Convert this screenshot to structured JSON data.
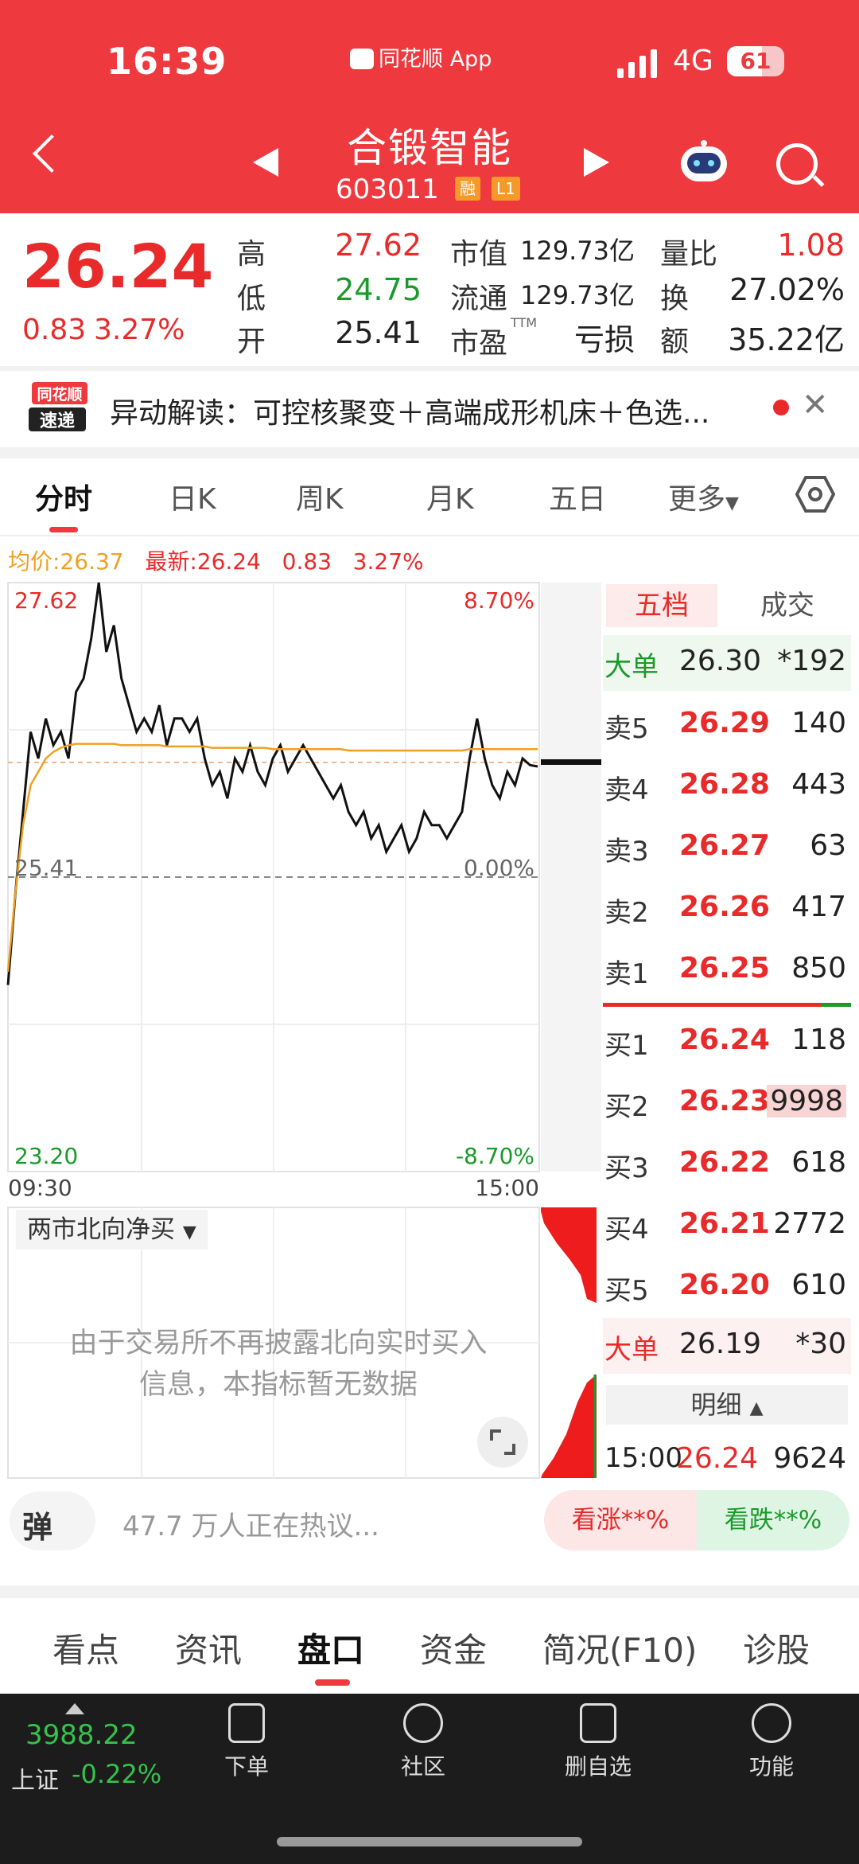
{
  "status": {
    "time": "16:39",
    "app": "同花顺 App",
    "network": "4G",
    "battery": "61"
  },
  "header": {
    "name": "合锻智能",
    "code": "603011",
    "tags": [
      "融",
      "L1"
    ]
  },
  "quote": {
    "price": "26.24",
    "change": "0.83",
    "change_pct": "3.27%",
    "high_label": "高",
    "high": "27.62",
    "low_label": "低",
    "low": "24.75",
    "open_label": "开",
    "open": "25.41",
    "mktcap_label": "市值",
    "mktcap": "129.73亿",
    "float_label": "流通",
    "float": "129.73亿",
    "pe_label": "市盈",
    "pe_sup": "TTM",
    "pe": "亏损",
    "volratio_label": "量比",
    "volratio": "1.08",
    "turnover_label": "换",
    "turnover": "27.02%",
    "amount_label": "额",
    "amount": "35.22亿"
  },
  "news": {
    "logo_top": "同花顺",
    "logo_bottom": "速递",
    "text": "异动解读：可控核聚变＋高端成形机床＋色选..."
  },
  "tabs": [
    "分时",
    "日K",
    "周K",
    "月K",
    "五日",
    "更多"
  ],
  "avgline": {
    "avg_label": "均价:",
    "avg": "26.37",
    "latest_label": "最新:",
    "latest": "26.24",
    "chg": "0.83",
    "pct": "3.27%"
  },
  "chart_data": {
    "type": "line",
    "title": "",
    "y_labels": {
      "top_left": "27.62",
      "top_right": "8.70%",
      "mid_left": "25.41",
      "mid_right": "0.00%",
      "bottom_left": "23.20",
      "bottom_right": "-8.70%"
    },
    "x_labels": [
      "09:30",
      "15:00"
    ],
    "ylim": [
      23.2,
      27.62
    ],
    "prev_close": 25.41,
    "series": [
      {
        "name": "最新",
        "color": "#111111",
        "values": [
          24.6,
          25.3,
          25.9,
          26.5,
          26.3,
          26.6,
          26.4,
          26.5,
          26.3,
          26.8,
          26.9,
          27.2,
          27.62,
          27.1,
          27.3,
          26.9,
          26.7,
          26.5,
          26.6,
          26.5,
          26.7,
          26.4,
          26.6,
          26.6,
          26.5,
          26.6,
          26.3,
          26.1,
          26.2,
          26.0,
          26.3,
          26.2,
          26.4,
          26.2,
          26.1,
          26.3,
          26.4,
          26.2,
          26.3,
          26.4,
          26.3,
          26.2,
          26.1,
          26.0,
          26.1,
          25.9,
          25.8,
          25.9,
          25.7,
          25.8,
          25.6,
          25.7,
          25.8,
          25.6,
          25.7,
          25.9,
          25.8,
          25.8,
          25.7,
          25.8,
          25.9,
          26.3,
          26.6,
          26.3,
          26.1,
          26.0,
          26.2,
          26.1,
          26.3,
          26.25,
          26.24
        ]
      },
      {
        "name": "均价",
        "color": "#f0a020",
        "values": [
          24.7,
          25.3,
          25.8,
          26.1,
          26.2,
          26.3,
          26.35,
          26.38,
          26.4,
          26.41,
          26.41,
          26.41,
          26.41,
          26.41,
          26.41,
          26.4,
          26.4,
          26.4,
          26.4,
          26.4,
          26.4,
          26.39,
          26.39,
          26.39,
          26.39,
          26.39,
          26.39,
          26.38,
          26.38,
          26.38,
          26.38,
          26.38,
          26.38,
          26.38,
          26.38,
          26.37,
          26.37,
          26.37,
          26.37,
          26.37,
          26.37,
          26.37,
          26.37,
          26.37,
          26.37,
          26.36,
          26.36,
          26.36,
          26.36,
          26.36,
          26.36,
          26.36,
          26.36,
          26.36,
          26.36,
          26.36,
          26.36,
          26.36,
          26.36,
          26.36,
          26.36,
          26.37,
          26.37,
          26.37,
          26.37,
          26.37,
          26.37,
          26.37,
          26.37,
          26.37,
          26.37
        ]
      }
    ]
  },
  "orderbook": {
    "tabs": [
      "五档",
      "成交"
    ],
    "big_sell": {
      "label": "大单",
      "price": "26.30",
      "vol": "*192"
    },
    "asks": [
      {
        "label": "卖5",
        "price": "26.29",
        "vol": "140"
      },
      {
        "label": "卖4",
        "price": "26.28",
        "vol": "443"
      },
      {
        "label": "卖3",
        "price": "26.27",
        "vol": "63"
      },
      {
        "label": "卖2",
        "price": "26.26",
        "vol": "417"
      },
      {
        "label": "卖1",
        "price": "26.25",
        "vol": "850"
      }
    ],
    "bids": [
      {
        "label": "买1",
        "price": "26.24",
        "vol": "118"
      },
      {
        "label": "买2",
        "price": "26.23",
        "vol": "9998"
      },
      {
        "label": "买3",
        "price": "26.22",
        "vol": "618"
      },
      {
        "label": "买4",
        "price": "26.21",
        "vol": "2772"
      },
      {
        "label": "买5",
        "price": "26.20",
        "vol": "610"
      }
    ],
    "big_buy": {
      "label": "大单",
      "price": "26.19",
      "vol": "*30"
    },
    "detail_label": "明细",
    "trade": {
      "time": "15:00",
      "price": "26.24",
      "vol": "9624"
    }
  },
  "north": {
    "selector": "两市北向净买",
    "message_line1": "由于交易所不再披露北向实时买入",
    "message_line2": "信息，本指标暂无数据"
  },
  "social": {
    "danmu": "弹",
    "hot": "47.7 万人正在热议...",
    "rise": "看涨**%",
    "fall": "看跌**%"
  },
  "bottom_tabs": [
    "看点",
    "资讯",
    "盘口",
    "资金",
    "简况(F10)",
    "诊股"
  ],
  "footer": {
    "index_value": "3988.22",
    "index_name": "上证",
    "index_change": "-0.22%",
    "items": [
      "下单",
      "社区",
      "删自选",
      "功能"
    ]
  }
}
